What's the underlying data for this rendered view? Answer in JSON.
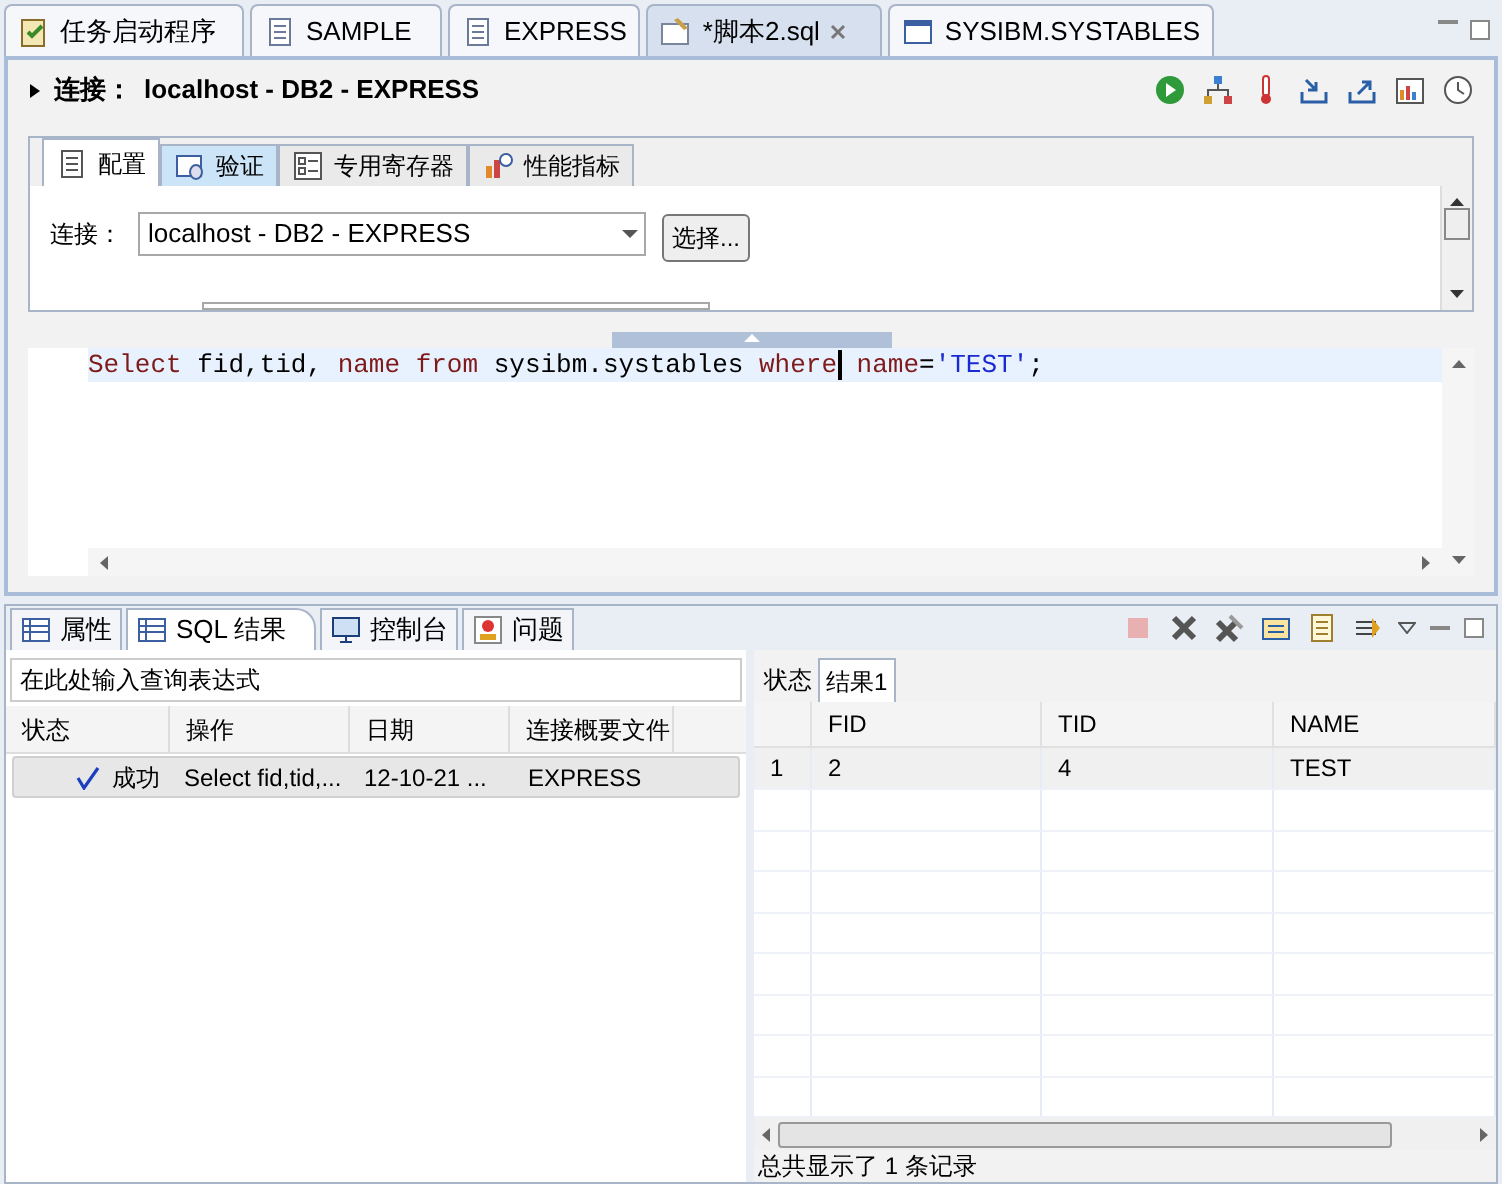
{
  "editor_tabs": [
    {
      "label": "任务启动程序",
      "selected": false,
      "kind": "task"
    },
    {
      "label": "SAMPLE",
      "selected": false,
      "kind": "db"
    },
    {
      "label": "EXPRESS",
      "selected": false,
      "kind": "db"
    },
    {
      "label": "*脚本2.sql",
      "selected": true,
      "kind": "sql"
    },
    {
      "label": "SYSIBM.SYSTABLES",
      "selected": false,
      "kind": "table"
    }
  ],
  "connection_header": {
    "label": "连接：",
    "value": "localhost - DB2 - EXPRESS",
    "expanded": false
  },
  "config_tabs": [
    {
      "label": "配置",
      "selected": true,
      "hovered": false
    },
    {
      "label": "验证",
      "selected": false,
      "hovered": true
    },
    {
      "label": "专用寄存器",
      "selected": false,
      "hovered": false
    },
    {
      "label": "性能指标",
      "selected": false,
      "hovered": false
    }
  ],
  "connection_field": {
    "label": "连接：",
    "value": "localhost - DB2 - EXPRESS",
    "button": "选择..."
  },
  "sql_tokens": [
    {
      "kind": "keyword",
      "text": "Select"
    },
    {
      "kind": "plain",
      "text": " fid,tid, "
    },
    {
      "kind": "keyword",
      "text": "name from"
    },
    {
      "kind": "plain",
      "text": " sysibm.systables "
    },
    {
      "kind": "keyword",
      "text": "where"
    },
    {
      "kind": "caret"
    },
    {
      "kind": "keyword",
      "text": " name"
    },
    {
      "kind": "plain",
      "text": "="
    },
    {
      "kind": "string",
      "text": "'TEST'"
    },
    {
      "kind": "plain",
      "text": ";"
    }
  ],
  "bottom_tabs": [
    {
      "label": "属性",
      "selected": false,
      "kind": "properties"
    },
    {
      "label": "SQL 结果",
      "selected": true,
      "kind": "results"
    },
    {
      "label": "控制台",
      "selected": false,
      "kind": "console"
    },
    {
      "label": "问题",
      "selected": false,
      "kind": "problems"
    }
  ],
  "filter_field": {
    "placeholder": "在此处输入查询表达式"
  },
  "history": {
    "columns": [
      "状态",
      "操作",
      "日期",
      "连接概要文件"
    ],
    "rows": [
      {
        "status": "成功",
        "success": true,
        "operation": "Select fid,tid,...",
        "date": "12-10-21 ...",
        "profile": "EXPRESS",
        "selected": true
      }
    ]
  },
  "result_tabs": [
    {
      "label": "状态",
      "selected": false
    },
    {
      "label": "结果1",
      "selected": true
    }
  ],
  "result": {
    "columns": [
      "FID",
      "TID",
      "NAME"
    ],
    "rows": [
      {
        "number": "1",
        "cells": [
          "2",
          "4",
          "TEST"
        ]
      }
    ]
  },
  "status_text": "总共显示了 1 条记录"
}
